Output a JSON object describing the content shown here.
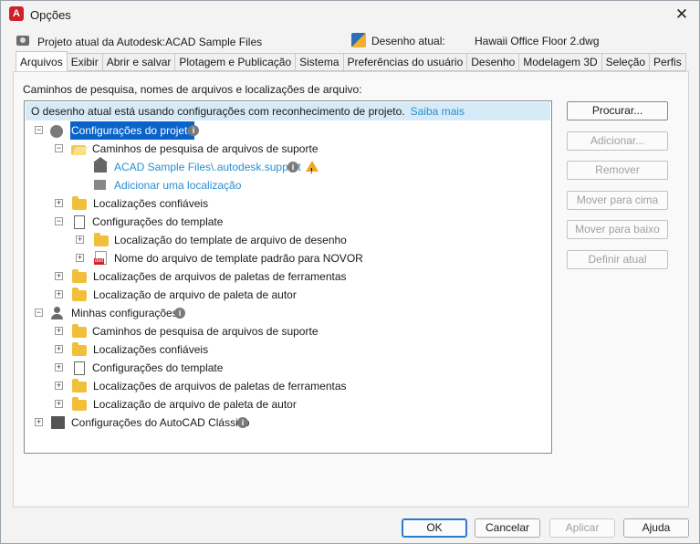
{
  "window": {
    "title": "Opções",
    "app_icon_letter": "A"
  },
  "info": {
    "project_label": "Projeto atual da Autodesk:",
    "project_value": "ACAD Sample Files",
    "drawing_label": "Desenho atual:",
    "drawing_value": "Hawaii Office Floor 2.dwg"
  },
  "tabs": [
    {
      "label": "Arquivos"
    },
    {
      "label": "Exibir"
    },
    {
      "label": "Abrir e salvar"
    },
    {
      "label": "Plotagem e Publicação"
    },
    {
      "label": "Sistema"
    },
    {
      "label": "Preferências do usuário"
    },
    {
      "label": "Desenho"
    },
    {
      "label": "Modelagem 3D"
    },
    {
      "label": "Seleção"
    },
    {
      "label": "Perfis"
    }
  ],
  "panel": {
    "caption": "Caminhos de pesquisa, nomes de arquivos e localizações de arquivo:",
    "banner_text": "O desenho atual está usando configurações com reconhecimento de projeto.",
    "banner_link": "Saiba mais"
  },
  "tree": {
    "r1": "Configurações do projeto",
    "r2": "Caminhos de pesquisa de arquivos de suporte",
    "r3": "ACAD Sample Files\\.autodesk.support",
    "r4": "Adicionar uma localização",
    "r5": "Localizações confiáveis",
    "r6": "Configurações do template",
    "r7": "Localização do template de arquivo de desenho",
    "r8": "Nome do arquivo de template padrão para NOVOR",
    "r9": "Localizações de arquivos de paletas de ferramentas",
    "r10": "Localização de arquivo de paleta de autor",
    "r11": "Minhas configurações",
    "r12": "Caminhos de pesquisa de arquivos de suporte",
    "r13": "Localizações confiáveis",
    "r14": "Configurações do template",
    "r15": "Localizações de arquivos de paletas de ferramentas",
    "r16": "Localização de arquivo de paleta de autor",
    "r17": "Configurações do AutoCAD Clássico"
  },
  "side_buttons": {
    "browse": "Procurar...",
    "add": "Adicionar...",
    "remove": "Remover",
    "move_up": "Mover para cima",
    "move_down": "Mover para baixo",
    "set_current": "Definir atual"
  },
  "bottom_buttons": {
    "ok": "OK",
    "cancel": "Cancelar",
    "apply": "Aplicar",
    "help": "Ajuda"
  },
  "colors": {
    "selection": "#0a63c9",
    "link": "#2a8fd1",
    "banner": "#d6ebf7",
    "folder": "#f2bf3a",
    "warning": "#f0a81c"
  }
}
